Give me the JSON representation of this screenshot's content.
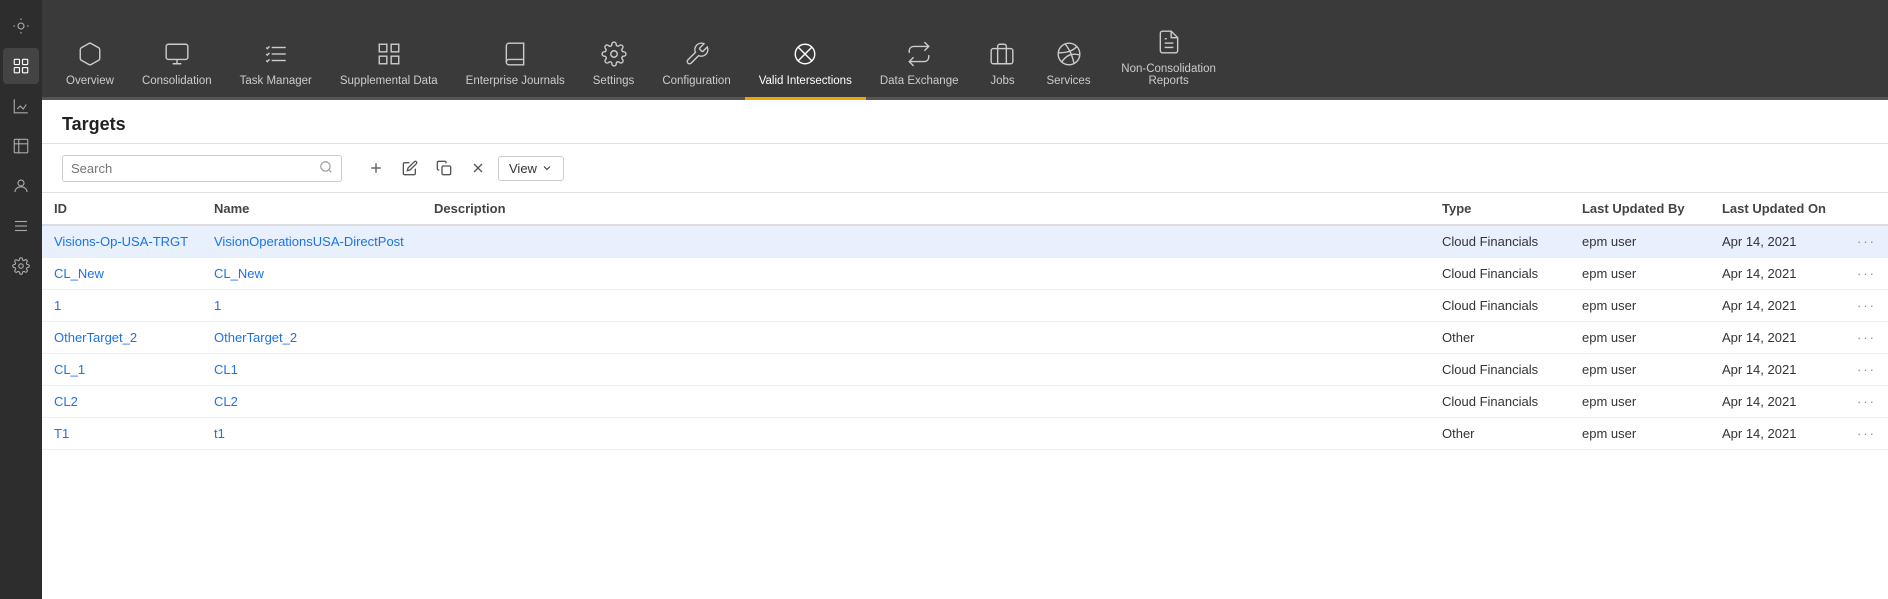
{
  "sidebar": {
    "icons": [
      {
        "name": "home-icon",
        "symbol": "⌂"
      },
      {
        "name": "targets-icon",
        "symbol": "◈"
      },
      {
        "name": "chart-icon",
        "symbol": "▦"
      },
      {
        "name": "table-icon",
        "symbol": "▤"
      },
      {
        "name": "list-icon",
        "symbol": "≡"
      },
      {
        "name": "settings-icon",
        "symbol": "⚙"
      }
    ]
  },
  "nav": {
    "items": [
      {
        "label": "Overview",
        "icon": "cube"
      },
      {
        "label": "Consolidation",
        "icon": "consolidation"
      },
      {
        "label": "Task Manager",
        "icon": "tasks"
      },
      {
        "label": "Supplemental Data",
        "icon": "grid"
      },
      {
        "label": "Enterprise Journals",
        "icon": "book"
      },
      {
        "label": "Settings",
        "icon": "gear"
      },
      {
        "label": "Configuration",
        "icon": "config"
      },
      {
        "label": "Valid Intersections",
        "icon": "intersections"
      },
      {
        "label": "Data Exchange",
        "icon": "exchange"
      },
      {
        "label": "Jobs",
        "icon": "jobs"
      },
      {
        "label": "Services",
        "icon": "services"
      },
      {
        "label": "Non-Consolidation Reports",
        "icon": "reports"
      }
    ]
  },
  "page": {
    "title": "Targets"
  },
  "toolbar": {
    "search_placeholder": "Search",
    "view_label": "View"
  },
  "table": {
    "columns": [
      "ID",
      "Name",
      "Description",
      "Type",
      "Last Updated By",
      "Last Updated On"
    ],
    "rows": [
      {
        "id": "Visions-Op-USA-TRGT",
        "name": "VisionOperationsUSA-DirectPost",
        "description": "",
        "type": "Cloud Financials",
        "updatedBy": "epm user",
        "updatedOn": "Apr 14, 2021",
        "selected": true
      },
      {
        "id": "CL_New",
        "name": "CL_New",
        "description": "",
        "type": "Cloud Financials",
        "updatedBy": "epm user",
        "updatedOn": "Apr 14, 2021",
        "selected": false
      },
      {
        "id": "1",
        "name": "1",
        "description": "",
        "type": "Cloud Financials",
        "updatedBy": "epm user",
        "updatedOn": "Apr 14, 2021",
        "selected": false
      },
      {
        "id": "OtherTarget_2",
        "name": "OtherTarget_2",
        "description": "",
        "type": "Other",
        "updatedBy": "epm user",
        "updatedOn": "Apr 14, 2021",
        "selected": false
      },
      {
        "id": "CL_1",
        "name": "CL1",
        "description": "",
        "type": "Cloud Financials",
        "updatedBy": "epm user",
        "updatedOn": "Apr 14, 2021",
        "selected": false
      },
      {
        "id": "CL2",
        "name": "CL2",
        "description": "",
        "type": "Cloud Financials",
        "updatedBy": "epm user",
        "updatedOn": "Apr 14, 2021",
        "selected": false
      },
      {
        "id": "T1",
        "name": "t1",
        "description": "",
        "type": "Other",
        "updatedBy": "epm user",
        "updatedOn": "Apr 14, 2021",
        "selected": false
      }
    ]
  }
}
